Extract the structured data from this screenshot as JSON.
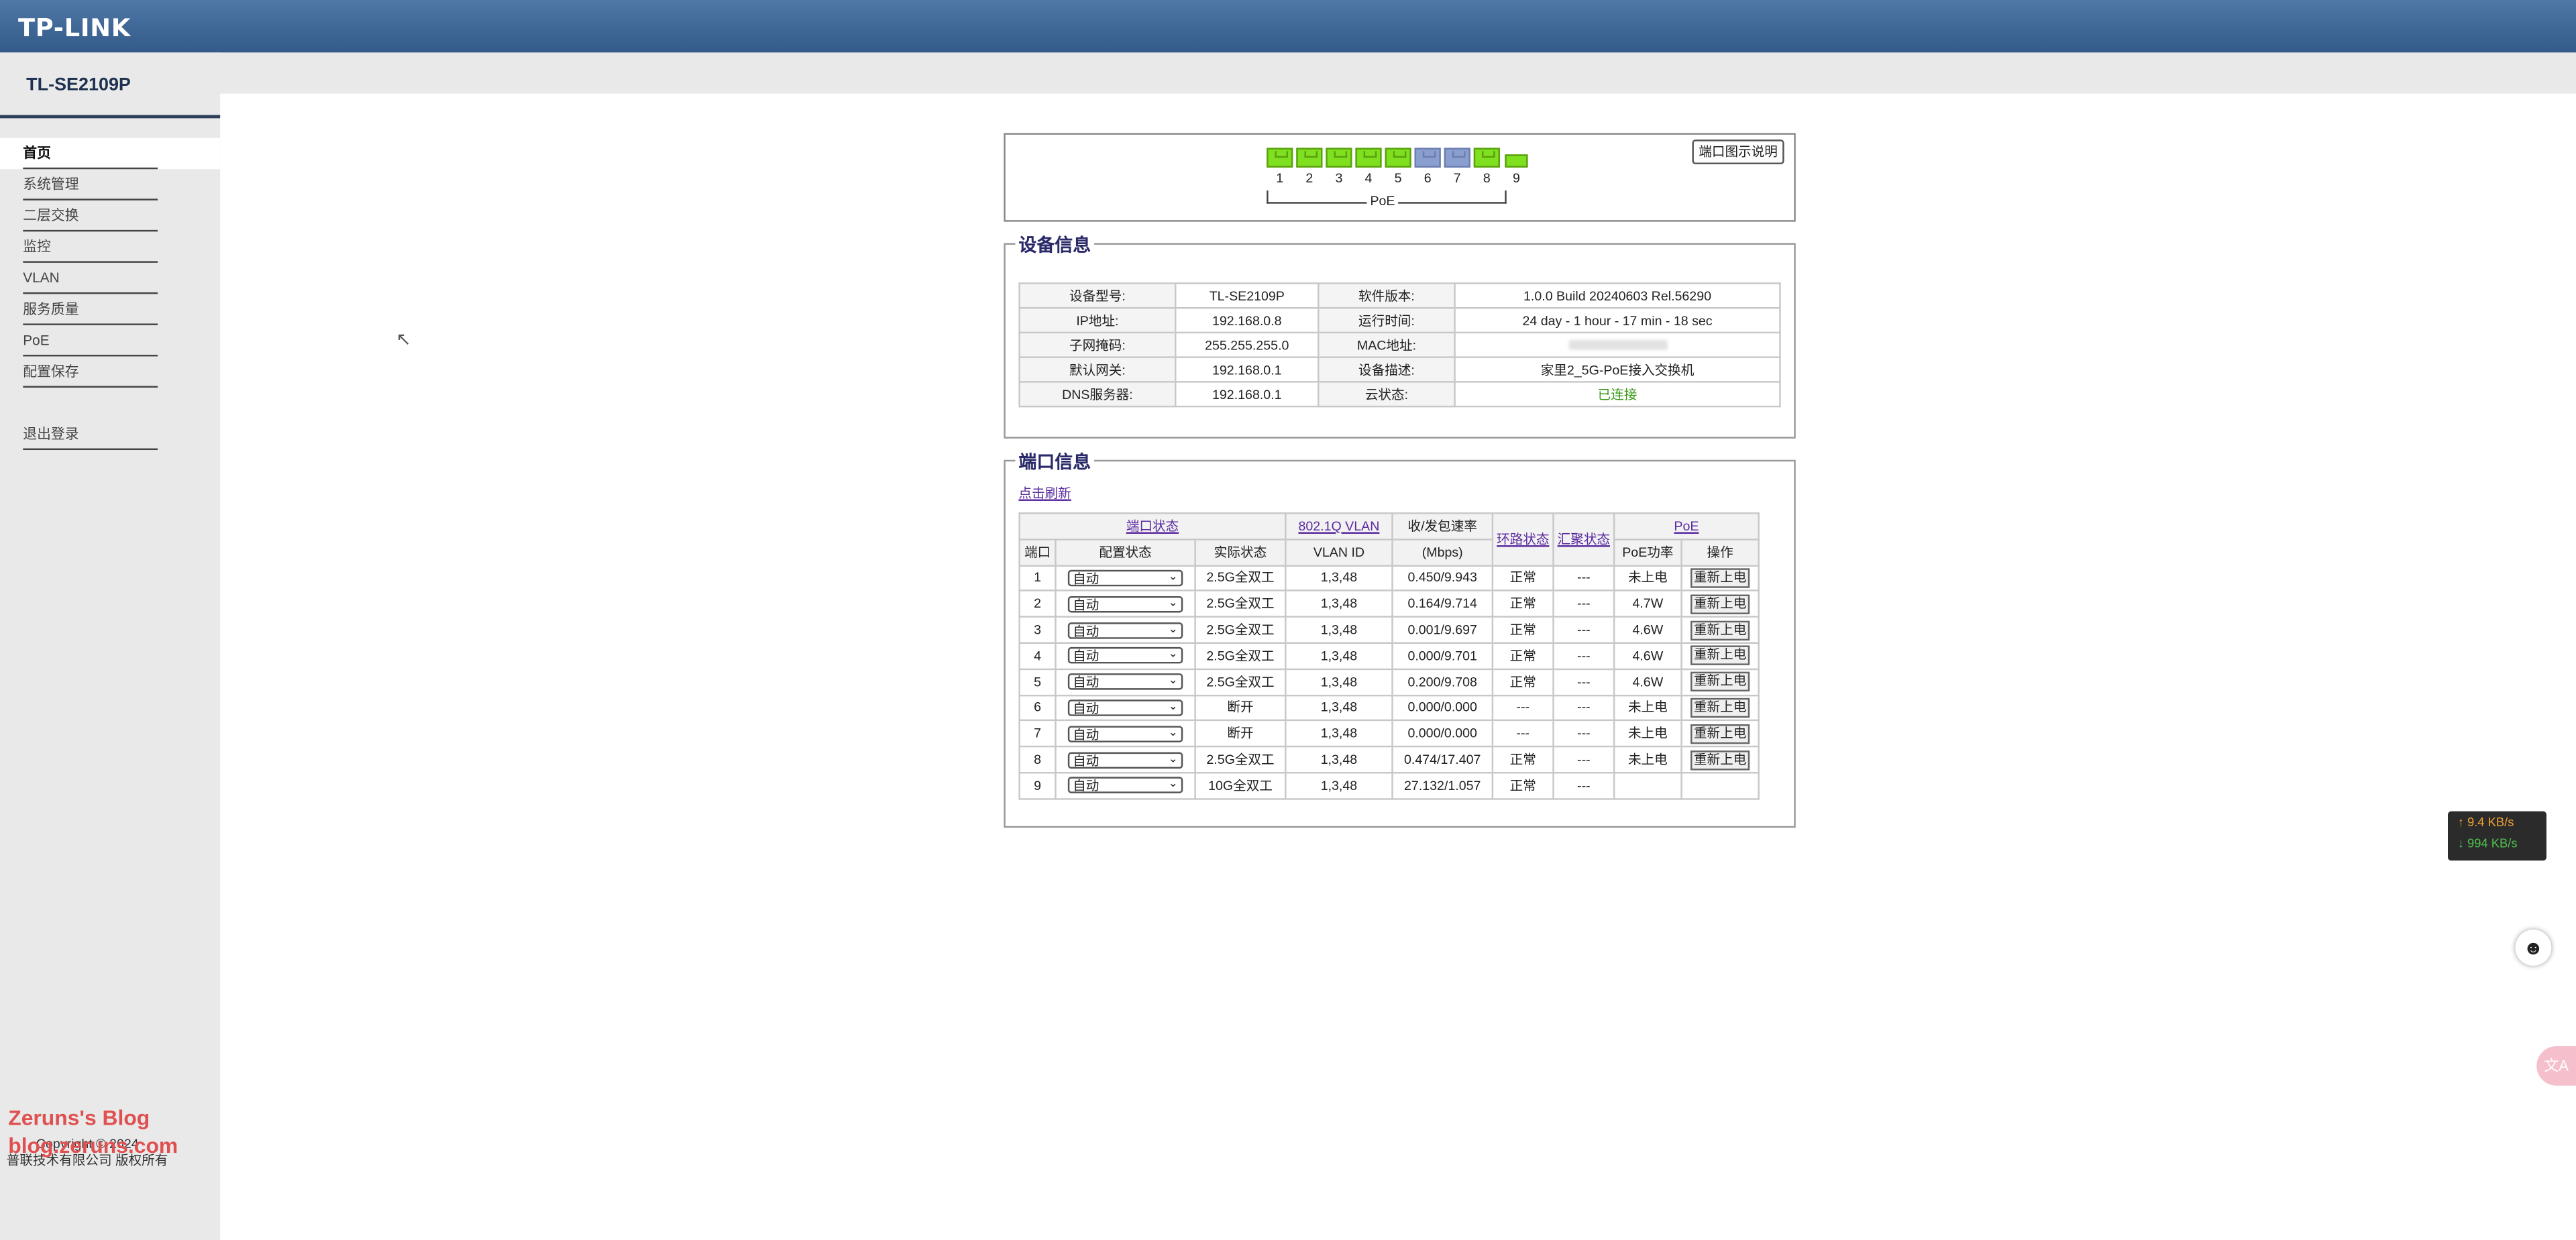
{
  "header": {
    "brand": "TP-LINK"
  },
  "sidebar": {
    "model": "TL-SE2109P",
    "items": [
      {
        "label": "首页"
      },
      {
        "label": "系统管理"
      },
      {
        "label": "二层交换"
      },
      {
        "label": "监控"
      },
      {
        "label": "VLAN"
      },
      {
        "label": "服务质量"
      },
      {
        "label": "PoE"
      },
      {
        "label": "配置保存"
      }
    ],
    "logout": "退出登录",
    "copyright_line1": "Copyright © 2024",
    "copyright_line2": "普联技术有限公司 版权所有"
  },
  "watermark": {
    "line1": "Zeruns's Blog",
    "line2": "blog.zeruns.com"
  },
  "port_panel": {
    "legend_button": "端口图示说明",
    "ports": [
      "1",
      "2",
      "3",
      "4",
      "5",
      "6",
      "7",
      "8",
      "9"
    ],
    "poe_label": "PoE"
  },
  "device_info": {
    "title": "设备信息",
    "rows": [
      {
        "l1": "设备型号:",
        "v1": "TL-SE2109P",
        "l2": "软件版本:",
        "v2": "1.0.0 Build 20240603 Rel.56290"
      },
      {
        "l1": "IP地址:",
        "v1": "192.168.0.8",
        "l2": "运行时间:",
        "v2": "24 day - 1 hour - 17 min - 18 sec"
      },
      {
        "l1": "子网掩码:",
        "v1": "255.255.255.0",
        "l2": "MAC地址:",
        "v2": ""
      },
      {
        "l1": "默认网关:",
        "v1": "192.168.0.1",
        "l2": "设备描述:",
        "v2": "家里2_5G-PoE接入交换机"
      },
      {
        "l1": "DNS服务器:",
        "v1": "192.168.0.1",
        "l2": "云状态:",
        "v2": "已连接"
      }
    ]
  },
  "port_info": {
    "title": "端口信息",
    "refresh": "点击刷新",
    "headers": {
      "port_status": "端口状态",
      "vlan": "802.1Q VLAN",
      "rate": "收/发包速率",
      "rate_unit": "(Mbps)",
      "loop": "环路状态",
      "lag": "汇聚状态",
      "poe": "PoE",
      "port": "端口",
      "config": "配置状态",
      "actual": "实际状态",
      "vlan_id": "VLAN ID",
      "poe_power": "PoE功率",
      "action": "操作"
    },
    "rows": [
      {
        "port": "1",
        "config": "自动",
        "actual": "2.5G全双工",
        "vlan": "1,3,48",
        "rate": "0.450/9.943",
        "loop": "正常",
        "lag": "---",
        "poe": "未上电",
        "action": "重新上电"
      },
      {
        "port": "2",
        "config": "自动",
        "actual": "2.5G全双工",
        "vlan": "1,3,48",
        "rate": "0.164/9.714",
        "loop": "正常",
        "lag": "---",
        "poe": "4.7W",
        "action": "重新上电"
      },
      {
        "port": "3",
        "config": "自动",
        "actual": "2.5G全双工",
        "vlan": "1,3,48",
        "rate": "0.001/9.697",
        "loop": "正常",
        "lag": "---",
        "poe": "4.6W",
        "action": "重新上电"
      },
      {
        "port": "4",
        "config": "自动",
        "actual": "2.5G全双工",
        "vlan": "1,3,48",
        "rate": "0.000/9.701",
        "loop": "正常",
        "lag": "---",
        "poe": "4.6W",
        "action": "重新上电"
      },
      {
        "port": "5",
        "config": "自动",
        "actual": "2.5G全双工",
        "vlan": "1,3,48",
        "rate": "0.200/9.708",
        "loop": "正常",
        "lag": "---",
        "poe": "4.6W",
        "action": "重新上电"
      },
      {
        "port": "6",
        "config": "自动",
        "actual": "断开",
        "vlan": "1,3,48",
        "rate": "0.000/0.000",
        "loop": "---",
        "lag": "---",
        "poe": "未上电",
        "action": "重新上电"
      },
      {
        "port": "7",
        "config": "自动",
        "actual": "断开",
        "vlan": "1,3,48",
        "rate": "0.000/0.000",
        "loop": "---",
        "lag": "---",
        "poe": "未上电",
        "action": "重新上电"
      },
      {
        "port": "8",
        "config": "自动",
        "actual": "2.5G全双工",
        "vlan": "1,3,48",
        "rate": "0.474/17.407",
        "loop": "正常",
        "lag": "---",
        "poe": "未上电",
        "action": "重新上电"
      },
      {
        "port": "9",
        "config": "自动",
        "actual": "10G全双工",
        "vlan": "1,3,48",
        "rate": "27.132/1.057",
        "loop": "正常",
        "lag": "---",
        "poe": "",
        "action": ""
      }
    ]
  },
  "netspeed": {
    "up": "↑ 9.4 KB/s",
    "down": "↓ 994 KB/s"
  },
  "colors": {
    "header": "#3d6596",
    "sidebar": "#e9e9e9",
    "port_up": "#7fe01f",
    "port_down": "#8a9ed0",
    "cloud_ok": "#3a9a1a"
  }
}
